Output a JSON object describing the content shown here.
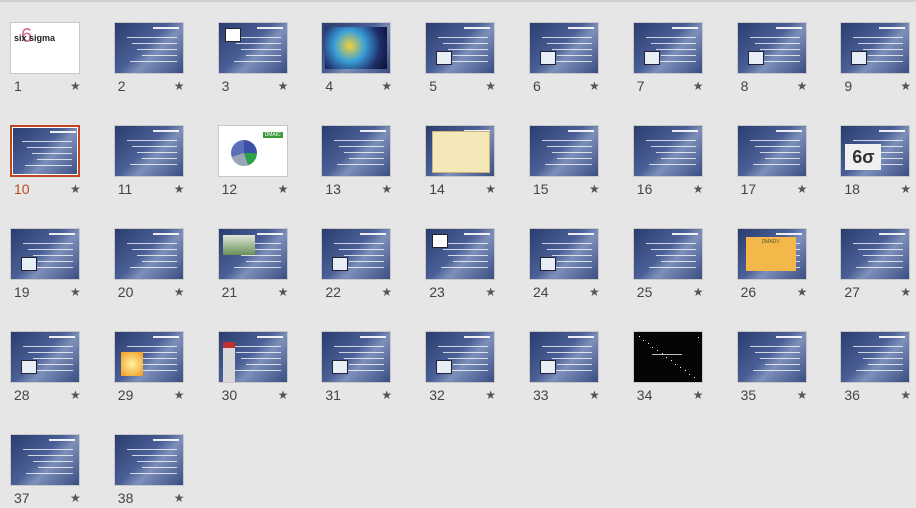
{
  "selected_slide": 10,
  "star_glyph": "★",
  "slides": [
    {
      "number": "1",
      "style": "white",
      "pic": "logo",
      "logo_text": "six sigma"
    },
    {
      "number": "2",
      "style": "blue",
      "pic": "none"
    },
    {
      "number": "3",
      "style": "blue",
      "pic": "small-logo"
    },
    {
      "number": "4",
      "style": "blue",
      "pic": "photo"
    },
    {
      "number": "5",
      "style": "blue",
      "pic": "small-icon"
    },
    {
      "number": "6",
      "style": "blue",
      "pic": "small-icon"
    },
    {
      "number": "7",
      "style": "blue",
      "pic": "small-icon"
    },
    {
      "number": "8",
      "style": "blue",
      "pic": "small-icon"
    },
    {
      "number": "9",
      "style": "blue",
      "pic": "small-icon"
    },
    {
      "number": "10",
      "style": "blue",
      "pic": "none"
    },
    {
      "number": "11",
      "style": "blue",
      "pic": "none"
    },
    {
      "number": "12",
      "style": "white",
      "pic": "diagram",
      "label": "DMAIC"
    },
    {
      "number": "13",
      "style": "blue",
      "pic": "none"
    },
    {
      "number": "14",
      "style": "blue",
      "pic": "chart"
    },
    {
      "number": "15",
      "style": "blue",
      "pic": "none"
    },
    {
      "number": "16",
      "style": "blue",
      "pic": "none"
    },
    {
      "number": "17",
      "style": "blue",
      "pic": "none"
    },
    {
      "number": "18",
      "style": "blue",
      "pic": "sigma",
      "label": "6σ"
    },
    {
      "number": "19",
      "style": "blue",
      "pic": "small-icon"
    },
    {
      "number": "20",
      "style": "blue",
      "pic": "none"
    },
    {
      "number": "21",
      "style": "blue",
      "pic": "banner"
    },
    {
      "number": "22",
      "style": "blue",
      "pic": "small-icon"
    },
    {
      "number": "23",
      "style": "blue",
      "pic": "small-logo"
    },
    {
      "number": "24",
      "style": "blue",
      "pic": "small-icon"
    },
    {
      "number": "25",
      "style": "blue",
      "pic": "none"
    },
    {
      "number": "26",
      "style": "blue",
      "pic": "orange-box",
      "label": "DMADV"
    },
    {
      "number": "27",
      "style": "blue",
      "pic": "none"
    },
    {
      "number": "28",
      "style": "blue",
      "pic": "small-icon"
    },
    {
      "number": "29",
      "style": "blue",
      "pic": "orange-logo"
    },
    {
      "number": "30",
      "style": "blue",
      "pic": "side-logo"
    },
    {
      "number": "31",
      "style": "blue",
      "pic": "small-icon"
    },
    {
      "number": "32",
      "style": "blue",
      "pic": "small-icon"
    },
    {
      "number": "33",
      "style": "blue",
      "pic": "small-icon"
    },
    {
      "number": "34",
      "style": "black",
      "pic": "none"
    },
    {
      "number": "35",
      "style": "blue",
      "pic": "none"
    },
    {
      "number": "36",
      "style": "blue",
      "pic": "none"
    },
    {
      "number": "37",
      "style": "blue",
      "pic": "none"
    },
    {
      "number": "38",
      "style": "blue",
      "pic": "none"
    }
  ]
}
